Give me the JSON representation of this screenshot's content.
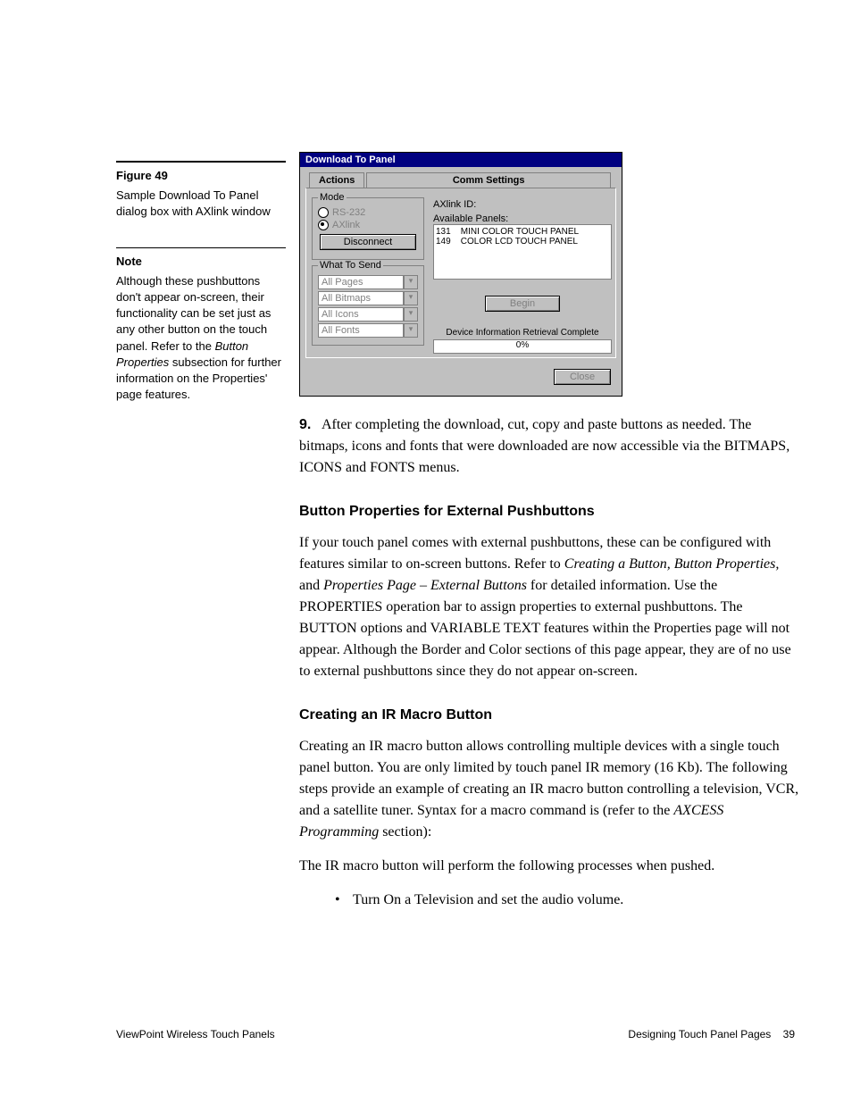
{
  "side": {
    "fig_label": "Figure 49",
    "fig_caption": "Sample Download To Panel dialog box with AXlink window",
    "note_label": "Note",
    "note_text_1": "Although these pushbuttons don't appear on-screen, their functionality can be set just as any other button on the touch panel. Refer to the ",
    "note_text_2": "Button Properties",
    "note_text_3": " subsection for further information on the Properties' page features."
  },
  "dialog": {
    "title": "Download To Panel",
    "tab_actions": "Actions",
    "tab_comm": "Comm Settings",
    "grp_mode": "Mode",
    "mode_rs232": "RS-232",
    "mode_axlink": "AXlink",
    "btn_disconnect": "Disconnect",
    "grp_send": "What To Send",
    "cb_pages": "All Pages",
    "cb_bitmaps": "All Bitmaps",
    "cb_icons": "All Icons",
    "cb_fonts": "All Fonts",
    "lbl_axid": "AXlink ID:",
    "lbl_avail": "Available Panels:",
    "panels": "131    MINI COLOR TOUCH PANEL\n149    COLOR LCD TOUCH PANEL",
    "btn_begin": "Begin",
    "status": "Device Information Retrieval Complete",
    "progress": "0%",
    "btn_close": "Close"
  },
  "step9": {
    "num": "9.",
    "text": "After completing the download, cut, copy and paste buttons as needed. The bitmaps, icons and fonts that were downloaded are now accessible via the BITMAPS, ICONS and FONTS menus."
  },
  "sec1": {
    "heading": "Button Properties for External Pushbuttons",
    "p1a": "If your touch panel comes with external pushbuttons, these can be configured with features similar to on-screen buttons. Refer to ",
    "p1b": "Creating a Button, Button Properties,",
    "p1c": " and ",
    "p1d": "Properties Page – External Buttons",
    "p1e": " for detailed information. Use the PROPERTIES operation bar to assign properties to external pushbuttons. The BUTTON options and VARIABLE TEXT features within the Properties page will not appear. Although the Border and Color sections of this page appear, they are of no use to external pushbuttons since they do not appear on-screen."
  },
  "sec2": {
    "heading": "Creating an IR Macro Button",
    "p1a": "Creating an IR macro button allows controlling multiple devices with a single touch panel button. You are only limited by touch panel IR memory (16 Kb). The following steps provide an example of creating an IR macro button controlling a television, VCR, and a satellite tuner. Syntax for a macro command is (refer to the ",
    "p1b": "AXCESS Programming",
    "p1c": " section):",
    "p2": "The IR macro button will perform the following processes when pushed.",
    "b1": "Turn On a Television and set the audio volume."
  },
  "footer": {
    "left": "ViewPoint Wireless Touch Panels",
    "right_a": "Designing Touch Panel Pages",
    "right_b": "39"
  }
}
